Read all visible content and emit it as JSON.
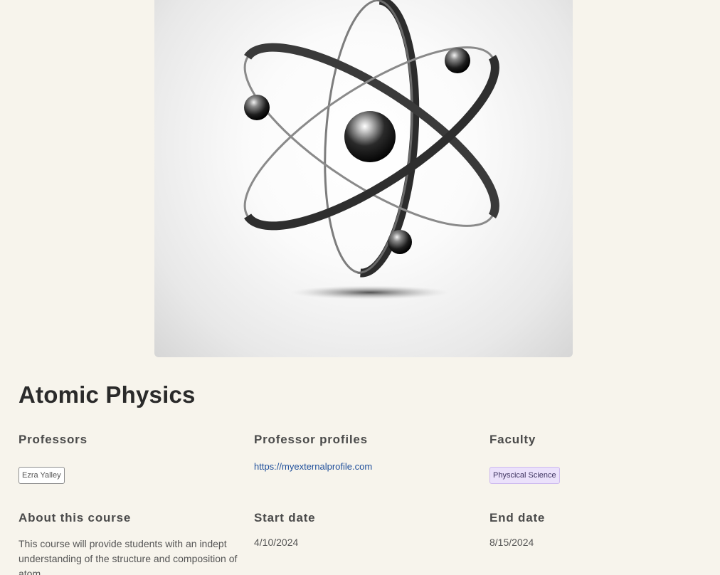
{
  "course": {
    "title": "Atomic Physics",
    "image_alt": "atom-illustration"
  },
  "professors": {
    "label": "Professors",
    "items": [
      "Ezra Yalley"
    ]
  },
  "profiles": {
    "label": "Professor profiles",
    "links": [
      "https://myexternalprofile.com"
    ]
  },
  "faculty": {
    "label": "Faculty",
    "items": [
      "Physcical Science"
    ]
  },
  "about": {
    "label": "About this course",
    "text": "This course will provide students with an indept understanding of the structure and composition of atom."
  },
  "start_date": {
    "label": "Start date",
    "value": "4/10/2024"
  },
  "end_date": {
    "label": "End date",
    "value": "8/15/2024"
  },
  "colors": {
    "background": "#f7f4ec",
    "link": "#1f4f9b",
    "faculty_chip_bg": "#ebe1fb"
  }
}
